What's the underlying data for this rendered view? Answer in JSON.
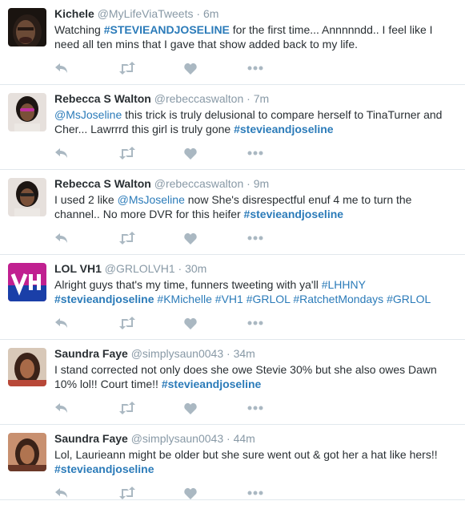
{
  "colors": {
    "link": "#2b7bb9",
    "muted": "#8899a6",
    "text": "#292f33",
    "icon": "#aab8c2",
    "divider": "#e1e8ed"
  },
  "icons": {
    "reply": "reply-icon",
    "retweet": "retweet-icon",
    "like": "heart-icon",
    "more": "more-icon"
  },
  "tweets": [
    {
      "name": "Kichele",
      "handle": "@MyLifeViaTweets",
      "time": "6m",
      "parts": [
        {
          "t": "Watching "
        },
        {
          "t": "#STEVIEANDJOSELINE",
          "k": "tag bold"
        },
        {
          "t": " for the first time... Annnnndd.. I feel like I need all ten mins that I gave that show added back to my life."
        }
      ]
    },
    {
      "name": "Rebecca S Walton",
      "handle": "@rebeccaswalton",
      "time": "7m",
      "parts": [
        {
          "t": "@MsJoseline",
          "k": "mention"
        },
        {
          "t": " this trick is truly delusional to compare herself to TinaTurner and Cher... Lawrrrd this girl is truly gone "
        },
        {
          "t": "#stevieandjoseline",
          "k": "tag bold"
        }
      ]
    },
    {
      "name": "Rebecca S Walton",
      "handle": "@rebeccaswalton",
      "time": "9m",
      "parts": [
        {
          "t": "I used 2 like "
        },
        {
          "t": "@MsJoseline",
          "k": "mention"
        },
        {
          "t": " now She's disrespectful enuf 4 me to turn the channel.. No more DVR for this heifer "
        },
        {
          "t": "#stevieandjoseline",
          "k": "tag bold"
        }
      ]
    },
    {
      "name": "LOL VH1",
      "handle": "@GRLOLVH1",
      "time": "30m",
      "parts": [
        {
          "t": "Alright guys that's my time, funners tweeting with ya'll "
        },
        {
          "t": "#LHHNY",
          "k": "tag"
        },
        {
          "t": "\n"
        },
        {
          "t": "#stevieandjoseline",
          "k": "tag bold"
        },
        {
          "t": " "
        },
        {
          "t": "#KMichelle",
          "k": "tag"
        },
        {
          "t": " "
        },
        {
          "t": "#VH1",
          "k": "tag"
        },
        {
          "t": " "
        },
        {
          "t": "#GRLOL",
          "k": "tag"
        },
        {
          "t": " "
        },
        {
          "t": "#RatchetMondays",
          "k": "tag"
        },
        {
          "t": " "
        },
        {
          "t": "#GRLOL",
          "k": "tag"
        }
      ]
    },
    {
      "name": "Saundra Faye",
      "handle": "@simplysaun0043",
      "time": "34m",
      "parts": [
        {
          "t": "I stand corrected not only does she owe Stevie 30% but she also owes Dawn 10% lol!! Court time!! "
        },
        {
          "t": "#stevieandjoseline",
          "k": "tag bold"
        }
      ]
    },
    {
      "name": "Saundra Faye",
      "handle": "@simplysaun0043",
      "time": "44m",
      "parts": [
        {
          "t": "Lol, Laurieann might be older but she sure went out & got her a hat like hers!! "
        },
        {
          "t": "#stevieandjoseline",
          "k": "tag bold"
        }
      ]
    }
  ]
}
